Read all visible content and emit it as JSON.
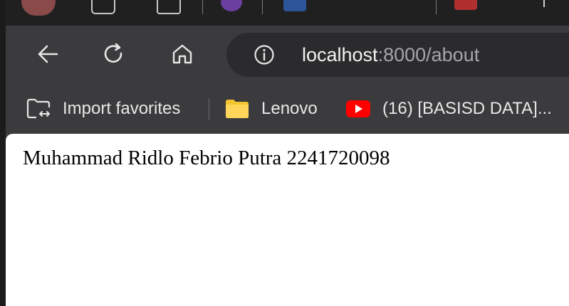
{
  "colors": {
    "chrome_background": "#3b3b3d",
    "tab_strip_background": "#202021",
    "address_bar_background": "#2b2b2d",
    "url_host_color": "#f2f2f2",
    "url_path_color": "#a6a6a8",
    "folder_color": "#f4c430",
    "youtube_red": "#ff0000",
    "page_background": "#ffffff"
  },
  "nav": {
    "back_icon": "arrow-left-icon",
    "refresh_icon": "refresh-icon",
    "home_icon": "home-icon"
  },
  "address_bar": {
    "site_info_icon": "info-icon",
    "url_host": "localhost",
    "url_rest": ":8000/about"
  },
  "bookmarks": [
    {
      "icon": "import-favorites-icon",
      "label": "Import favorites"
    },
    {
      "icon": "folder-icon",
      "label": "Lenovo"
    },
    {
      "icon": "youtube-icon",
      "label": "(16) [BASISD DATA]..."
    }
  ],
  "page": {
    "text": "Muhammad Ridlo Febrio Putra 2241720098"
  }
}
